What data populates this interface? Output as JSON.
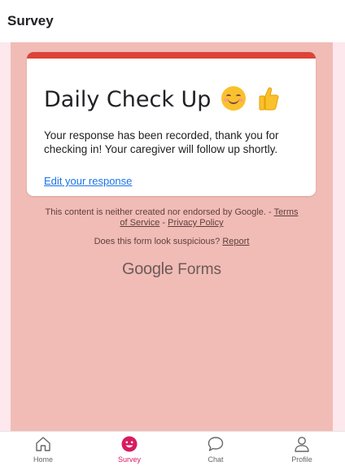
{
  "header": {
    "title": "Survey"
  },
  "form": {
    "title": "Daily Check Up",
    "message": "Your response has been recorded, thank you for checking in! Your caregiver will follow up shortly.",
    "edit_link": "Edit your response"
  },
  "footer": {
    "disclaimer": "This content is neither created nor endorsed by Google. -",
    "terms": "Terms of Service",
    "separator": "-",
    "privacy": "Privacy Policy",
    "suspicious_question": "Does this form look suspicious?",
    "report": "Report",
    "logo_google": "Google",
    "logo_forms": "Forms"
  },
  "nav": {
    "items": [
      {
        "label": "Home",
        "icon": "home-icon"
      },
      {
        "label": "Survey",
        "icon": "smile-icon"
      },
      {
        "label": "Chat",
        "icon": "chat-icon"
      },
      {
        "label": "Profile",
        "icon": "person-icon"
      }
    ],
    "active_color": "#d81b60"
  },
  "colors": {
    "accent": "#db4437",
    "form_background": "#f1bcb6",
    "link": "#1a73e8"
  }
}
